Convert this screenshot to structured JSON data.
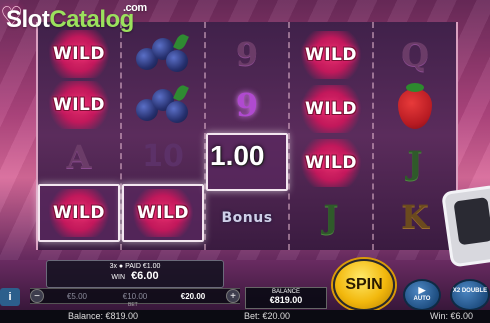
{
  "watermark": {
    "part1": "Slot",
    "part2": "Catalog",
    "suffix": ".com"
  },
  "reels": [
    [
      "wild",
      "wild",
      "A",
      "wild"
    ],
    [
      "blueberries",
      "blueberries",
      "10",
      "wild"
    ],
    [
      "9",
      "9",
      "1.00",
      "bonus"
    ],
    [
      "wild",
      "wild",
      "wild",
      "J"
    ],
    [
      "Q",
      "strawberry",
      "J",
      "K"
    ]
  ],
  "labels": {
    "wild": "WILD",
    "bonus": "Bonus"
  },
  "win_amount_on_reels": "1.00",
  "win_panel": {
    "line": "3x ● PAID €1.00",
    "win_label": "WIN",
    "win_value": "€6.00"
  },
  "bet_options": [
    "€5.00",
    "€10.00",
    "€20.00"
  ],
  "bet_selected": "€20.00",
  "bet_label": "BET",
  "balance_box": {
    "label": "BALANCE",
    "value": "€819.00"
  },
  "spin_label": "SPIN",
  "auto_label": "AUTO",
  "double_label": "X2 DOUBLE",
  "info_label": "i",
  "status_bar": {
    "balance": "Balance: €819.00",
    "bet": "Bet: €20.00",
    "win": "Win: €6.00"
  }
}
